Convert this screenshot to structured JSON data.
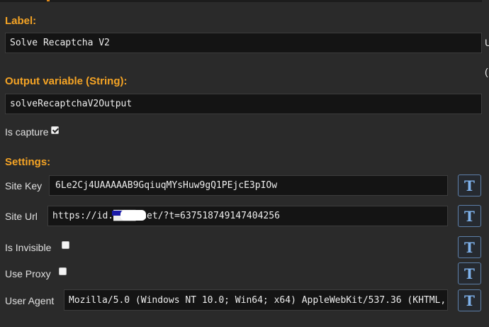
{
  "label_section": {
    "heading": "Label:",
    "value": "Solve Recaptcha V2"
  },
  "output_section": {
    "heading": "Output variable (String):",
    "value": "solveRecaptchaV2Output"
  },
  "capture": {
    "label": "Is capture",
    "checked": true
  },
  "settings": {
    "heading": "Settings:",
    "site_key": {
      "label": "Site Key",
      "value": "6Le2Cj4UAAAAAB9GqiuqMYsHuw9gQ1PEjcE3pIOw"
    },
    "site_url": {
      "label": "Site Url",
      "value": "https://id.████.net/?t=637518749147404256"
    },
    "is_invisible": {
      "label": "Is Invisible",
      "checked": false
    },
    "use_proxy": {
      "label": "Use Proxy",
      "checked": false
    },
    "user_agent": {
      "label": "User Agent",
      "value": "Mozilla/5.0 (Windows NT 10.0; Win64; x64) AppleWebKit/537.36 (KHTML,"
    }
  },
  "template_button": {
    "glyph": "T"
  },
  "edge_glyphs": [
    "U",
    "("
  ],
  "colors": {
    "heading": "#f5a425",
    "button_border": "#5d7fa8",
    "button_glyph": "#7fb2ec",
    "background": "#2a2a2a"
  }
}
